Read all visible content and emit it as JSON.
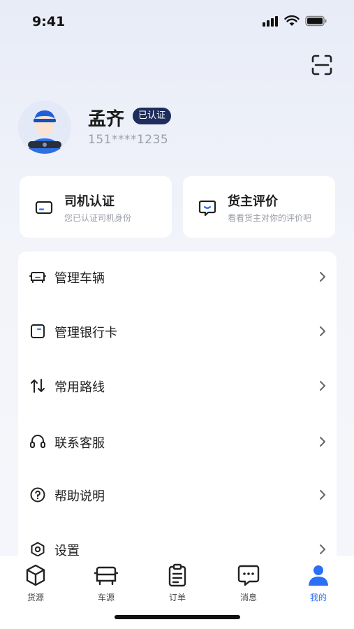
{
  "status": {
    "time": "9:41"
  },
  "profile": {
    "name": "孟齐",
    "badge": "已认证",
    "phone": "151****1235"
  },
  "cards": [
    {
      "title": "司机认证",
      "subtitle": "您已认证司机身份"
    },
    {
      "title": "货主评价",
      "subtitle": "看看货主对你的评价吧"
    }
  ],
  "menu": [
    {
      "label": "管理车辆",
      "icon": "vehicle-icon"
    },
    {
      "label": "管理银行卡",
      "icon": "bank-card-icon"
    },
    {
      "label": "常用路线",
      "icon": "route-icon"
    },
    {
      "label": "联系客服",
      "icon": "headset-icon"
    },
    {
      "label": "帮助说明",
      "icon": "help-icon"
    },
    {
      "label": "设置",
      "icon": "settings-icon"
    }
  ],
  "tabs": [
    {
      "label": "货源",
      "icon": "package-icon"
    },
    {
      "label": "车源",
      "icon": "truck-icon"
    },
    {
      "label": "订单",
      "icon": "clipboard-icon"
    },
    {
      "label": "消息",
      "icon": "message-icon"
    },
    {
      "label": "我的",
      "icon": "user-icon",
      "active": true
    }
  ],
  "colors": {
    "accent": "#2b6ff5",
    "badge_bg": "#1f2d5c"
  }
}
